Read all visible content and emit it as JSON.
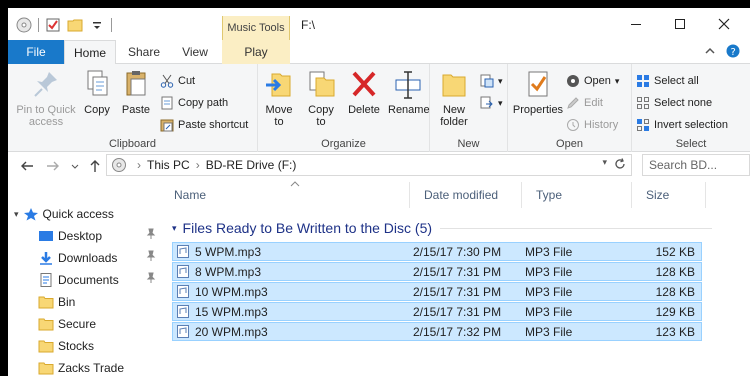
{
  "window": {
    "title": "F:\\"
  },
  "ribbon_tabs": {
    "file": "File",
    "home": "Home",
    "share": "Share",
    "view": "View",
    "play": "Play",
    "context": "Music Tools"
  },
  "clipboard": {
    "pin": "Pin to Quick access",
    "copy": "Copy",
    "paste": "Paste",
    "cut": "Cut",
    "copy_path": "Copy path",
    "paste_shortcut": "Paste shortcut",
    "label": "Clipboard"
  },
  "organize": {
    "move_to": "Move to",
    "copy_to": "Copy to",
    "delete": "Delete",
    "rename": "Rename",
    "label": "Organize"
  },
  "newgrp": {
    "new_folder": "New folder",
    "label": "New"
  },
  "opengrp": {
    "properties": "Properties",
    "open": "Open",
    "edit": "Edit",
    "history": "History",
    "label": "Open"
  },
  "selectgrp": {
    "select_all": "Select all",
    "select_none": "Select none",
    "invert": "Invert selection",
    "label": "Select"
  },
  "address": {
    "this_pc": "This PC",
    "drive": "BD-RE Drive (F:)",
    "search_placeholder": "Search BD..."
  },
  "nav": {
    "quick_access": "Quick access",
    "items": [
      {
        "label": "Desktop",
        "pinned": true
      },
      {
        "label": "Downloads",
        "pinned": true
      },
      {
        "label": "Documents",
        "pinned": true
      },
      {
        "label": "Bin",
        "pinned": false
      },
      {
        "label": "Secure",
        "pinned": false
      },
      {
        "label": "Stocks",
        "pinned": false
      },
      {
        "label": "Zacks Trade",
        "pinned": false
      }
    ]
  },
  "columns": {
    "name": "Name",
    "date": "Date modified",
    "type": "Type",
    "size": "Size"
  },
  "group_header": "Files Ready to Be Written to the Disc (5)",
  "files": [
    {
      "name": "5 WPM.mp3",
      "date": "2/15/17 7:30 PM",
      "type": "MP3 File",
      "size": "152 KB"
    },
    {
      "name": "8 WPM.mp3",
      "date": "2/15/17 7:31 PM",
      "type": "MP3 File",
      "size": "128 KB"
    },
    {
      "name": "10 WPM.mp3",
      "date": "2/15/17 7:31 PM",
      "type": "MP3 File",
      "size": "128 KB"
    },
    {
      "name": "15 WPM.mp3",
      "date": "2/15/17 7:31 PM",
      "type": "MP3 File",
      "size": "129 KB"
    },
    {
      "name": "20 WPM.mp3",
      "date": "2/15/17 7:32 PM",
      "type": "MP3 File",
      "size": "123 KB"
    }
  ],
  "colors": {
    "file_tab": "#1979ca",
    "selection": "#cce8ff",
    "selection_border": "#99d1ff",
    "group_header": "#1e3287",
    "context_tab": "#fbeec4"
  }
}
